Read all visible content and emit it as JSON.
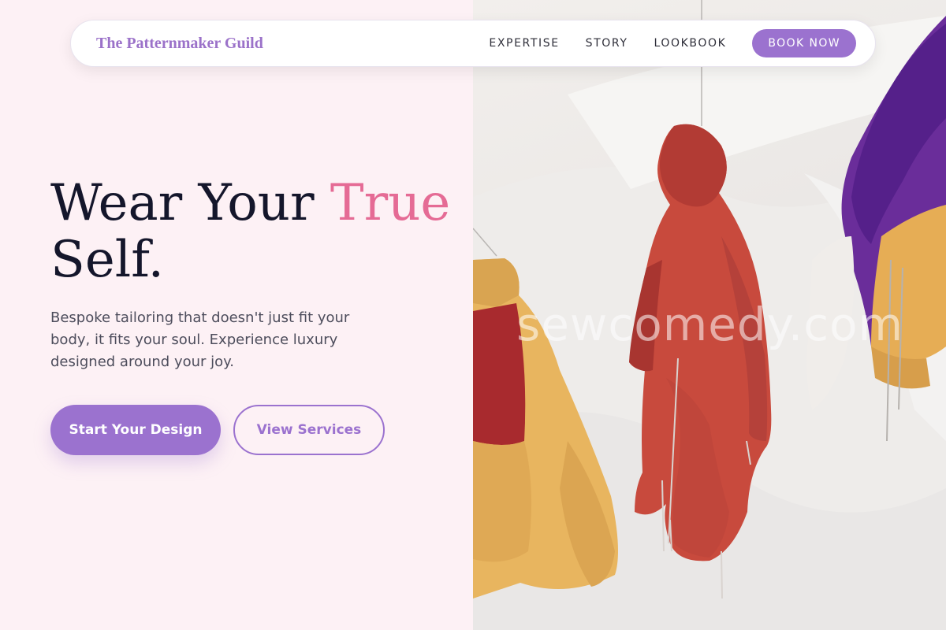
{
  "nav": {
    "brand": "The Patternmaker Guild",
    "links": [
      "EXPERTISE",
      "STORY",
      "LOOKBOOK"
    ],
    "cta": "BOOK NOW"
  },
  "hero": {
    "title_part1": "Wear Your ",
    "title_accent": "True",
    "title_part2": "Self.",
    "subtitle": "Bespoke tailoring that doesn't just fit your body, it fits your soul. Experience luxury designed around your joy.",
    "primary_button": "Start Your Design",
    "secondary_button": "View Services"
  },
  "image": {
    "watermark": "sewcomedy.com"
  },
  "colors": {
    "accent_purple": "#9b72cf",
    "accent_pink": "#e56b95",
    "background": "#fdf1f5",
    "title_dark": "#14162b"
  }
}
